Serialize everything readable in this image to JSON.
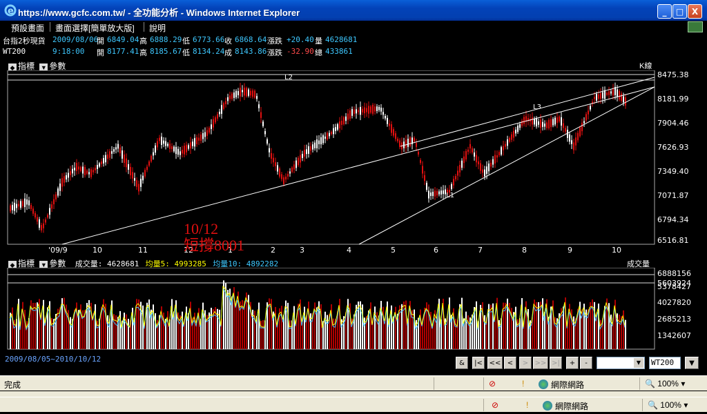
{
  "window": {
    "title": "https://www.gcfc.com.tw/ - 全功能分析 - Windows Internet Explorer",
    "minimize": "_",
    "maximize": "□",
    "close": "X"
  },
  "menu": {
    "items": [
      "預設畫面",
      "畫面選擇[簡單放大版]",
      "說明"
    ]
  },
  "quotes": [
    {
      "symbol": "台指2秒現貨",
      "time": "2009/08/06",
      "open_label": "開",
      "open": "6849.04",
      "high_label": "高",
      "high": "6888.29",
      "low_label": "低",
      "low": "6773.66",
      "close_label": "收",
      "close": "6868.64",
      "change_label": "漲跌",
      "change": "+20.40",
      "vol_label": "量",
      "volume": "4628681"
    },
    {
      "symbol": "WT200",
      "time": "9:18:00",
      "open_label": "開",
      "open": "8177.41",
      "high_label": "高",
      "high": "8185.67",
      "low_label": "低",
      "low": "8134.24",
      "close_label": "成",
      "close": "8143.86",
      "change_label": "漲跌",
      "change": "-32.90",
      "vol_label": "總",
      "volume": "433861"
    }
  ],
  "price_panel": {
    "indicator_label": "指標",
    "param_label": "參數",
    "kline_label": "K線",
    "y_ticks": [
      "8475.38",
      "8181.99",
      "7904.46",
      "7626.93",
      "7349.40",
      "7071.87",
      "6794.34",
      "6516.81"
    ],
    "x_ticks": [
      "'09/9",
      "10",
      "11",
      "12",
      "1",
      "2",
      "3",
      "4",
      "5",
      "6",
      "7",
      "8",
      "9",
      "10"
    ],
    "annotations": {
      "l2": "L2",
      "l3": "L3",
      "l1": "L1",
      "note_date": "10/12",
      "note_text": "短撐8001"
    }
  },
  "volume_panel": {
    "indicator_label": "指標",
    "param_label": "參數",
    "vol_text": "成交量: 4628681",
    "ma5_text": "均量5: 4993285",
    "ma10_text": "均量10: 4892282",
    "title": "成交量",
    "y_ticks": [
      "6888156",
      "5603924",
      "5378427",
      "4027820",
      "2685213",
      "1342607"
    ]
  },
  "nav": {
    "range": "2009/08/05~2010/10/12",
    "buttons": [
      "&",
      "|<",
      "<<",
      "<",
      ">",
      ">>",
      ">|",
      "+",
      "-"
    ],
    "symbol_value": "WT200"
  },
  "status1": {
    "text": "完成",
    "zone": "網際網路",
    "zoom": "100%"
  },
  "status2": {
    "zone": "網際網路",
    "zoom": "100%"
  },
  "colors": {
    "up": "#e01010",
    "down": "#ffffff",
    "ma5": "#ffff00",
    "ma10": "#3ec8ff",
    "bg": "#000000",
    "note": "#e01010"
  }
}
